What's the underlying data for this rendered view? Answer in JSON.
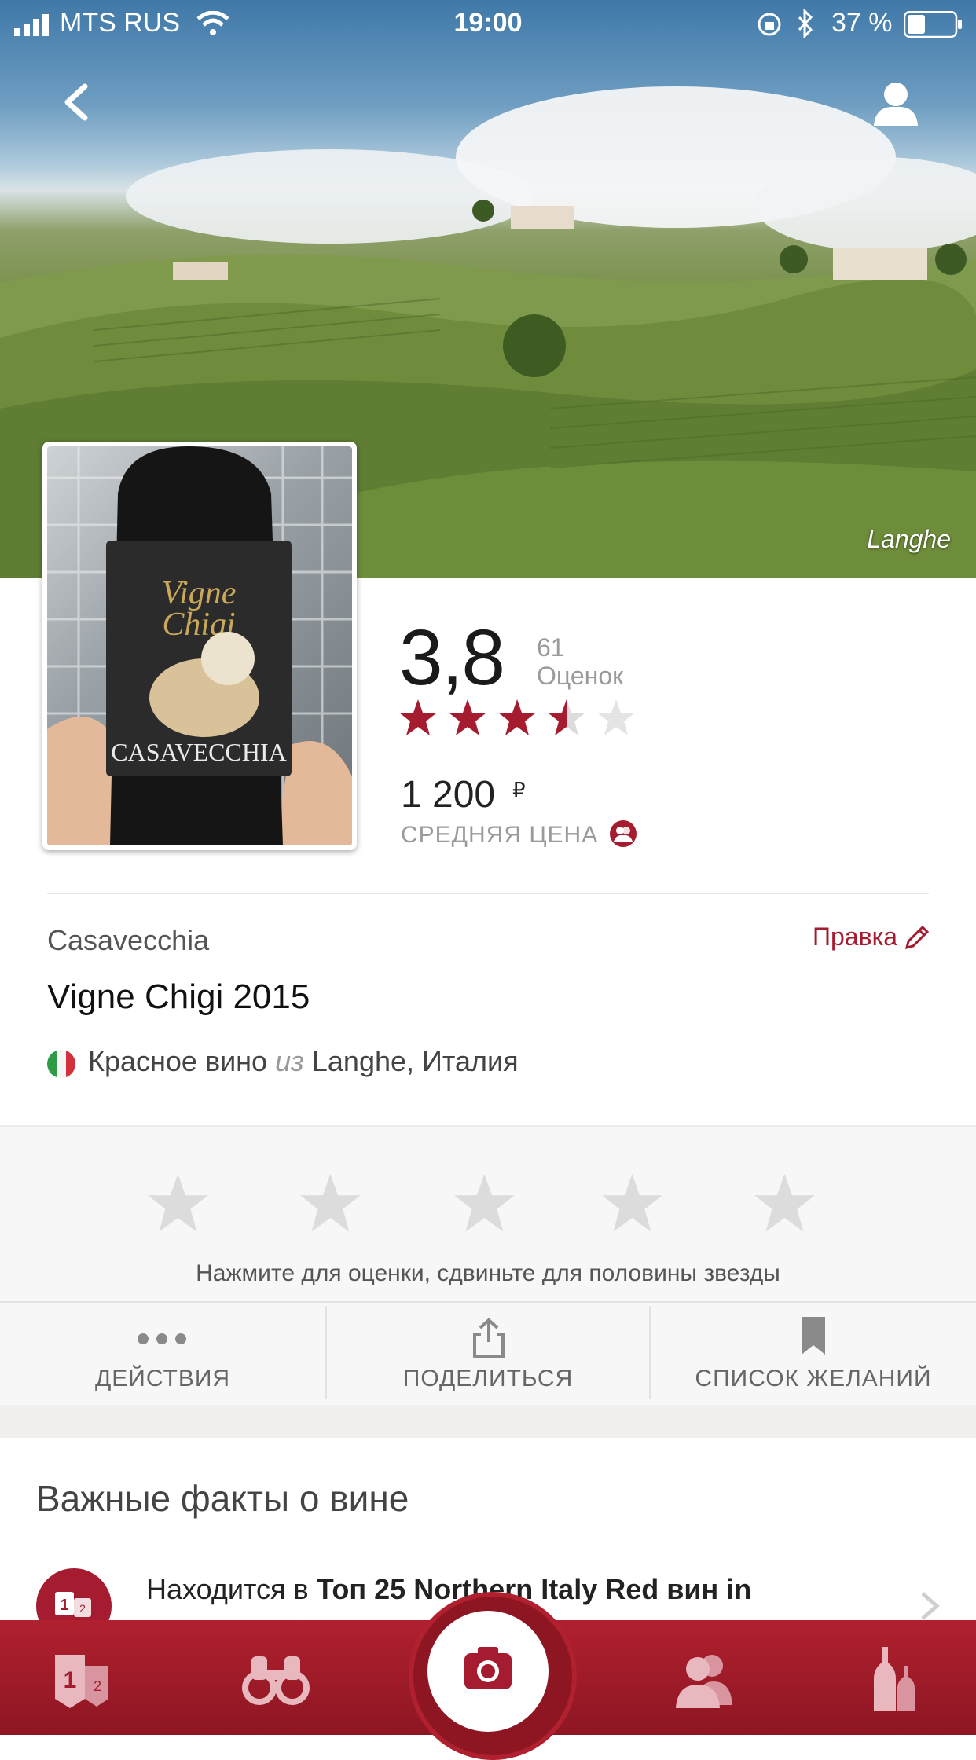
{
  "status_bar": {
    "carrier": "MTS RUS",
    "time": "19:00",
    "battery": "37 %"
  },
  "hero": {
    "region_caption": "Langhe"
  },
  "bottle_label": {
    "brand": "CASAVECCHIA",
    "script": "Vigne Chigi"
  },
  "rating": {
    "value": "3,8",
    "count": "61",
    "count_label": "Оценок",
    "stars": 3.8
  },
  "price": {
    "amount": "1 200",
    "currency": "₽",
    "label": "СРЕДНЯЯ ЦЕНА"
  },
  "wine": {
    "winery": "Casavecchia",
    "edit_label": "Правка",
    "name": "Vigne Chigi 2015",
    "type": "Красное вино",
    "from_word": "из",
    "region": "Langhe, Италия"
  },
  "rate_prompt": {
    "hint": "Нажмите для оценки, сдвиньте для половины звезды"
  },
  "actions": [
    {
      "label": "ДЕЙСТВИЯ",
      "icon": "more-dots-icon"
    },
    {
      "label": "ПОДЕЛИТЬСЯ",
      "icon": "share-icon"
    },
    {
      "label": "СПИСОК ЖЕЛАНИЙ",
      "icon": "bookmark-icon"
    }
  ],
  "facts": {
    "title": "Важные факты о вине",
    "item_prefix": "Находится в",
    "item_bold": "Топ 25 Northern Italy Red вин in"
  },
  "bottom_nav": [
    {
      "icon": "rankings-icon"
    },
    {
      "icon": "binoculars-icon"
    },
    {
      "icon": "camera-icon"
    },
    {
      "icon": "friends-icon"
    },
    {
      "icon": "bottles-icon"
    }
  ],
  "colors": {
    "accent": "#a51c30",
    "nav_bg": "#9c1a28",
    "star_filled": "#a51c30",
    "star_empty": "#dcdcdc"
  }
}
